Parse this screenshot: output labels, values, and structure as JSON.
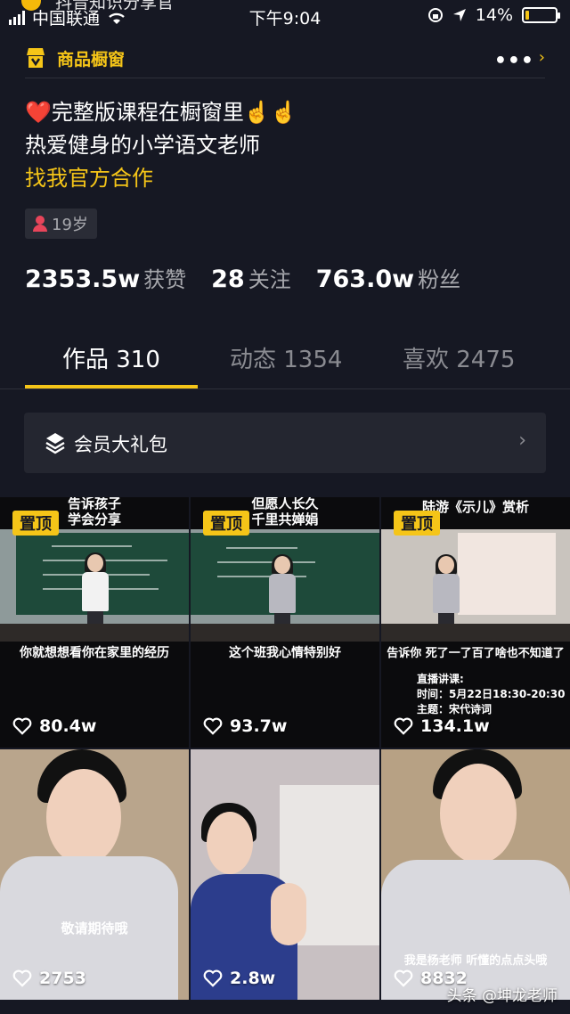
{
  "status_bar": {
    "carrier": "中国联通",
    "time": "下午9:04",
    "battery": "14%",
    "battery_level": 0.14,
    "overlay_text": "抖音知识分享官"
  },
  "shop": {
    "label": "商品橱窗",
    "more": "•••"
  },
  "bio": {
    "line1_heart": "❤️",
    "line1_text": "完整版课程在橱窗里",
    "line1_hands": "☝️☝️",
    "line2": "热爱健身的小学语文老师",
    "line3": "找我官方合作"
  },
  "age_tag": "19岁",
  "stats": [
    {
      "num": "2353.5w",
      "label": "获赞"
    },
    {
      "num": "28",
      "label": "关注"
    },
    {
      "num": "763.0w",
      "label": "粉丝"
    }
  ],
  "tabs": [
    {
      "label": "作品 310"
    },
    {
      "label": "动态 1354"
    },
    {
      "label": "喜欢 2475"
    }
  ],
  "gift": {
    "label": "会员大礼包"
  },
  "videos": [
    {
      "top_caption": "告诉孩子\n学会分享",
      "pinned": "置顶",
      "caption": "你就想想看你在家里的经历",
      "likes": "80.4w"
    },
    {
      "top_caption": "但愿人长久\n千里共婵娟",
      "pinned": "置顶",
      "caption": "这个班我心情特别好",
      "likes": "93.7w"
    },
    {
      "top_caption": "陆游《示儿》赏析",
      "pinned": "置顶",
      "caption": "告诉你 死了一了百了啥也不知道了",
      "live_label": "直播讲课:",
      "live_time": "时间：5月22日18:30-20:30",
      "live_topic": "主题：宋代诗词",
      "likes": "134.1w"
    },
    {
      "caption": "敬请期待哦",
      "likes": "2753"
    },
    {
      "caption": "",
      "likes": "2.8w"
    },
    {
      "caption": "我是杨老师 听懂的点点头哦",
      "likes": "8832"
    }
  ],
  "watermark": "头条 @坤龙老师",
  "colors": {
    "background": "#161823",
    "accent": "#f5c518",
    "muted": "#a7a8ad",
    "heart": "#e8263a"
  }
}
